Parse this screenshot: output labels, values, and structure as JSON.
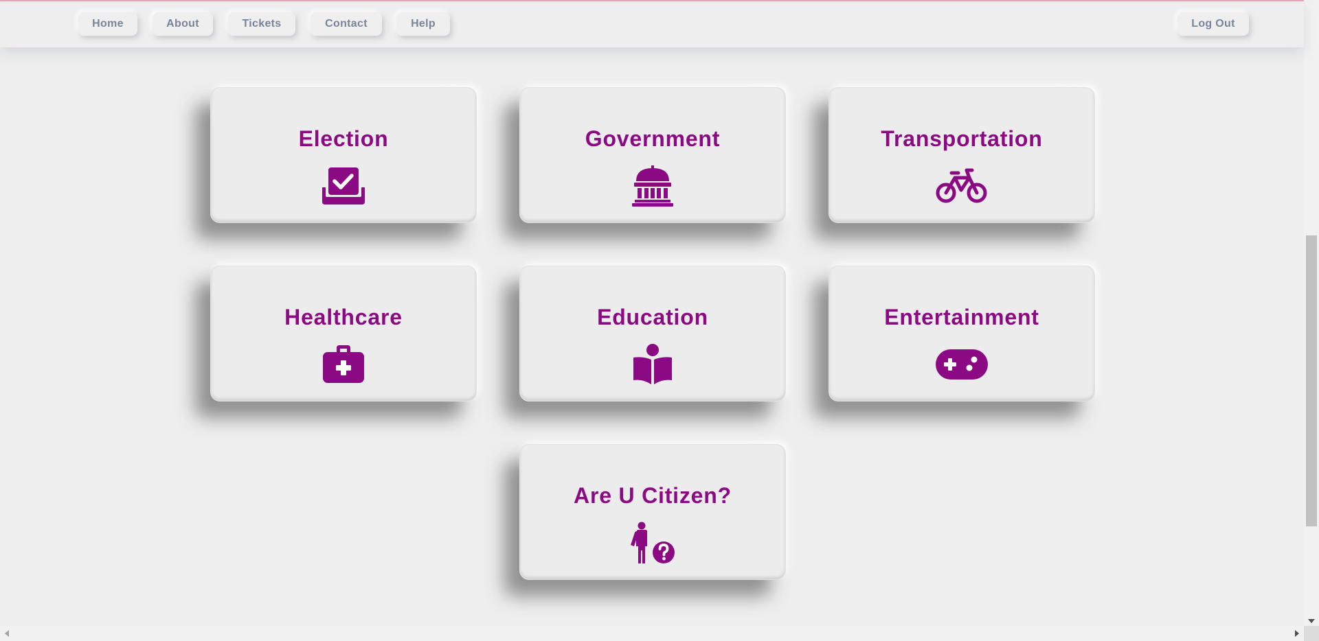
{
  "nav": {
    "home": "Home",
    "about": "About",
    "tickets": "Tickets",
    "contact": "Contact",
    "help": "Help",
    "logout": "Log Out"
  },
  "cards": {
    "election": {
      "title": "Election",
      "icon": "vote-ballot-icon"
    },
    "government": {
      "title": "Government",
      "icon": "government-building-icon"
    },
    "transportation": {
      "title": "Transportation",
      "icon": "bicycle-icon"
    },
    "healthcare": {
      "title": "Healthcare",
      "icon": "medical-kit-icon"
    },
    "education": {
      "title": "Education",
      "icon": "reading-person-icon"
    },
    "entertainment": {
      "title": "Entertainment",
      "icon": "gamepad-icon"
    },
    "citizen": {
      "title": "Are U Citizen?",
      "icon": "person-question-icon"
    }
  },
  "colors": {
    "accent": "#8b0a84",
    "nav_text": "#77849a",
    "background": "#eeeeee"
  }
}
